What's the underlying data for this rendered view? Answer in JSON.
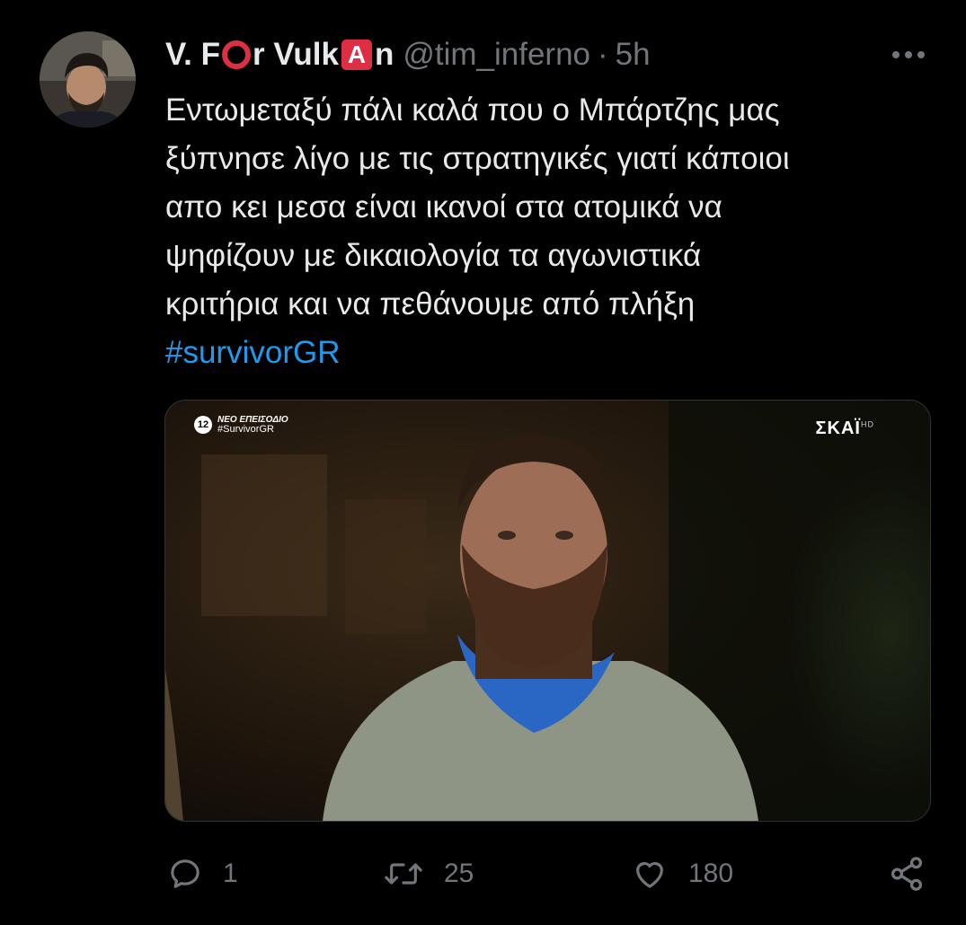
{
  "tweet": {
    "author": {
      "name_part1": "V. F",
      "name_part2": "r Vulk",
      "name_emoji_a": "A",
      "name_part3": "n",
      "handle": "@tim_inferno",
      "separator": "·",
      "time": "5h"
    },
    "text_lines": [
      "Εντωμεταξύ πάλι καλά που ο Μπάρτζης μας",
      "ξύπνησε λίγο με τις στρατηγικές γιατί κάποιοι",
      "απο κει μεσα είναι ικανοί στα ατομικά να",
      "ψηφίζουν με δικαιολογία τα αγωνιστικά",
      "κριτήρια και να πεθάνουμε από πλήξη"
    ],
    "hashtag": "#survivorGR",
    "media": {
      "overlay_badge": "12",
      "overlay_line1": "ΝΕΟ ΕΠΕΙΣΟΔΙΟ",
      "overlay_line2": "#SurvivorGR",
      "channel_logo": "ΣΚΑΪ",
      "channel_suffix": "HD"
    },
    "actions": {
      "replies": "1",
      "retweets": "25",
      "likes": "180"
    }
  },
  "colors": {
    "background": "#000000",
    "text": "#e7e9ea",
    "secondary": "#71767b",
    "link": "#1d9bf0",
    "emoji_red": "#dd2e44"
  },
  "icons": [
    "more-icon",
    "reply-icon",
    "retweet-icon",
    "like-icon",
    "share-icon"
  ]
}
